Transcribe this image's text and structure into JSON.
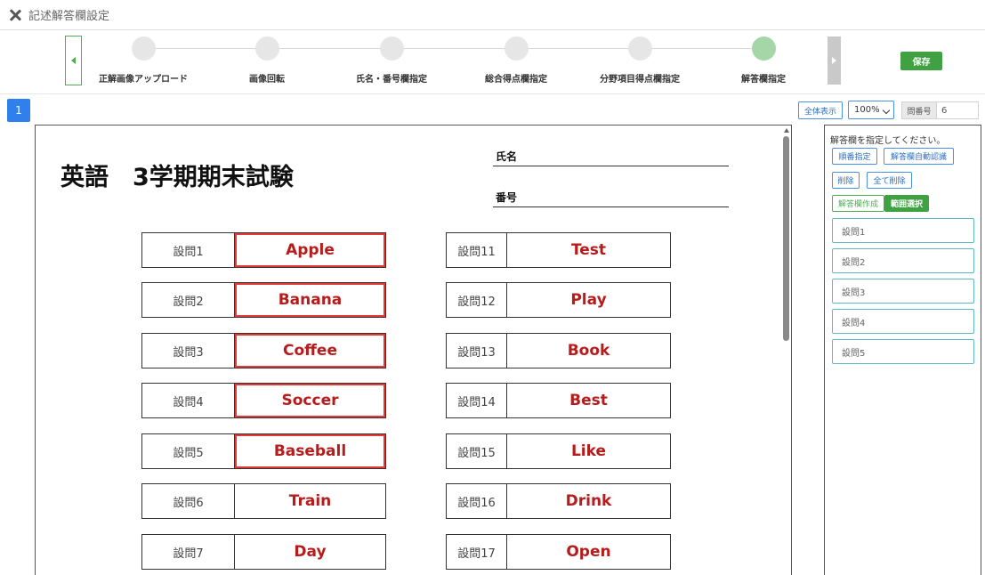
{
  "window": {
    "title": "記述解答欄設定"
  },
  "stepper": {
    "steps": [
      {
        "label": "正解画像アップロード",
        "state": "done"
      },
      {
        "label": "画像回転",
        "state": "done"
      },
      {
        "label": "氏名・番号欄指定",
        "state": "done"
      },
      {
        "label": "総合得点欄指定",
        "state": "done"
      },
      {
        "label": "分野項目得点欄指定",
        "state": "done"
      },
      {
        "label": "解答欄指定",
        "state": "active"
      }
    ],
    "save_label": "保存"
  },
  "toolbar": {
    "page_number": "1",
    "fit_label": "全体表示",
    "zoom_value": "100%",
    "question_number_label": "問番号",
    "question_number_value": "6"
  },
  "document": {
    "title": "英語　3学期期末試験",
    "name_label": "氏名",
    "number_label": "番号",
    "left_questions": [
      {
        "label": "設問1",
        "answer": "Apple",
        "selected": true
      },
      {
        "label": "設問2",
        "answer": "Banana",
        "selected": true
      },
      {
        "label": "設問3",
        "answer": "Coffee",
        "selected": true
      },
      {
        "label": "設問4",
        "answer": "Soccer",
        "selected": true
      },
      {
        "label": "設問5",
        "answer": "Baseball",
        "selected": true
      },
      {
        "label": "設問6",
        "answer": "Train",
        "selected": false
      },
      {
        "label": "設問7",
        "answer": "Day",
        "selected": false
      }
    ],
    "right_questions": [
      {
        "label": "設問11",
        "answer": "Test",
        "selected": false
      },
      {
        "label": "設問12",
        "answer": "Play",
        "selected": false
      },
      {
        "label": "設問13",
        "answer": "Book",
        "selected": false
      },
      {
        "label": "設問14",
        "answer": "Best",
        "selected": false
      },
      {
        "label": "設問15",
        "answer": "Like",
        "selected": false
      },
      {
        "label": "設問16",
        "answer": "Drink",
        "selected": false
      },
      {
        "label": "設問17",
        "answer": "Open",
        "selected": false
      }
    ]
  },
  "panel": {
    "hint": "解答欄を指定してください。",
    "sequential_label": "順番指定",
    "auto_detect_label": "解答欄自動認識",
    "delete_label": "削除",
    "delete_all_label": "全て削除",
    "create_label": "解答欄作成",
    "range_select_label": "範囲選択",
    "answer_fields": [
      "設問1",
      "設問2",
      "設問3",
      "設問4",
      "設問5"
    ]
  },
  "colors": {
    "accent_green": "#3fa142",
    "accent_blue": "#2f80ed",
    "answer_red": "#b71c1c",
    "selection_red": "#e53935"
  }
}
